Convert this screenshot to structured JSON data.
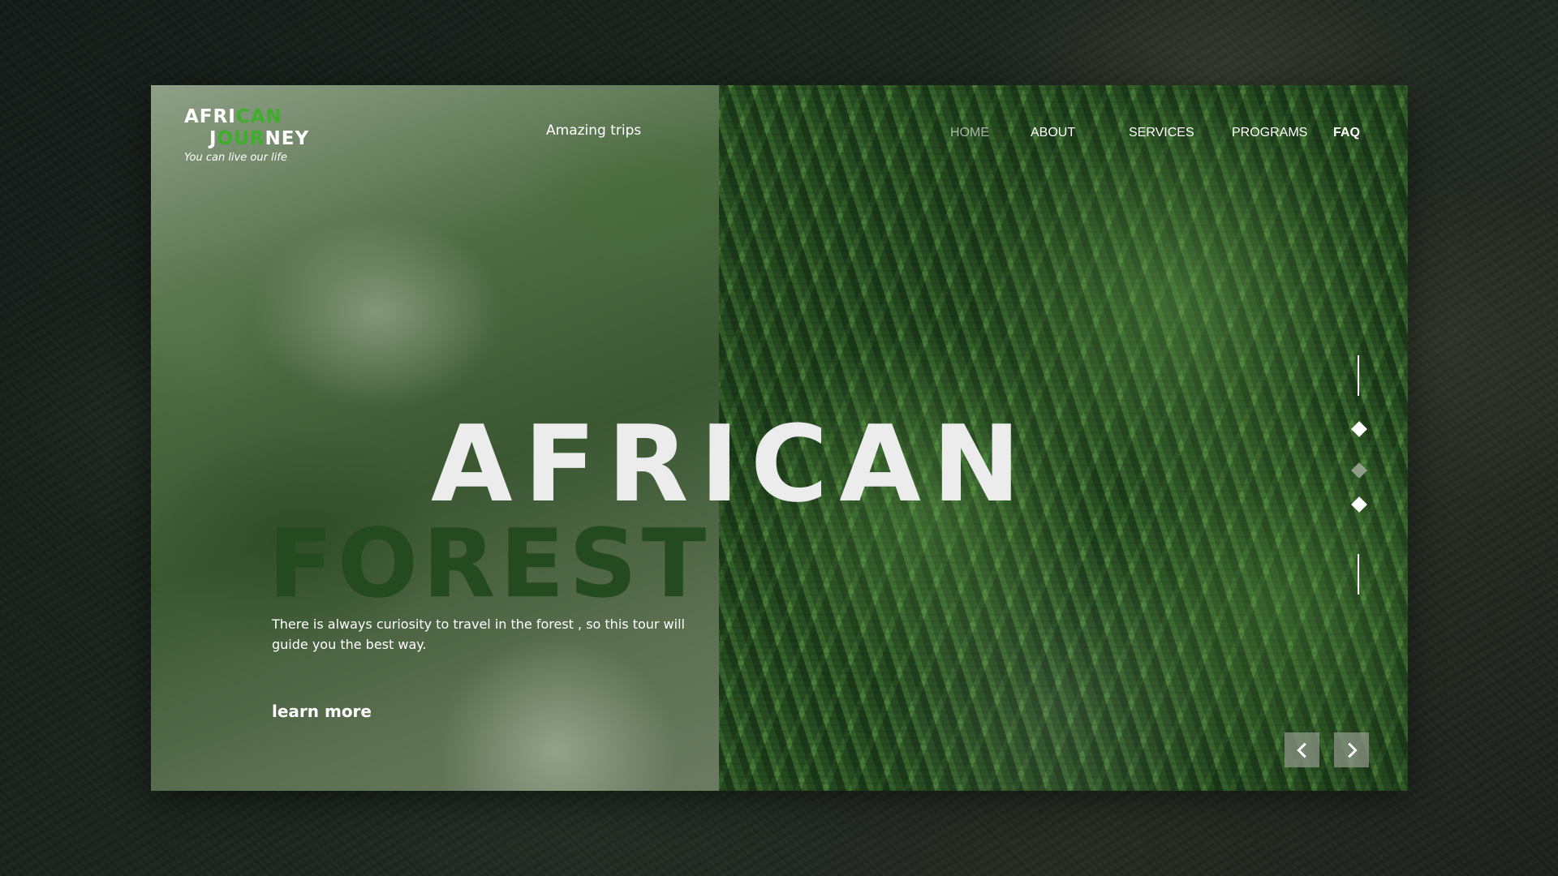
{
  "logo": {
    "line1_white": "AFRI",
    "line1_green": "CAN",
    "line2_white_a": "J",
    "line2_green": "OUR",
    "line2_white_b": "NEY",
    "tagline": "You can live our life"
  },
  "header": {
    "tagline_center": "Amazing trips"
  },
  "nav": {
    "items": [
      {
        "label": "HOME",
        "style": "muted"
      },
      {
        "label": "ABOUT",
        "style": "normal"
      },
      {
        "label": "SERVICES",
        "style": "normal"
      },
      {
        "label": "PROGRAMS",
        "style": "normal"
      },
      {
        "label": "FAQ",
        "style": "bold"
      }
    ]
  },
  "hero": {
    "title_line1": "AFRICAN",
    "title_line2": "FOREST",
    "description": "There is always curiosity to travel in the forest , so this tour will guide you the best way.",
    "cta": "learn more"
  },
  "slider": {
    "indicators": 3,
    "active_index": 1
  },
  "colors": {
    "accent_green": "#3fae2a",
    "forest_dark": "#244a1f",
    "title_light": "#ececec"
  },
  "icons": {
    "prev": "chevron-left-icon",
    "next": "chevron-right-icon"
  }
}
